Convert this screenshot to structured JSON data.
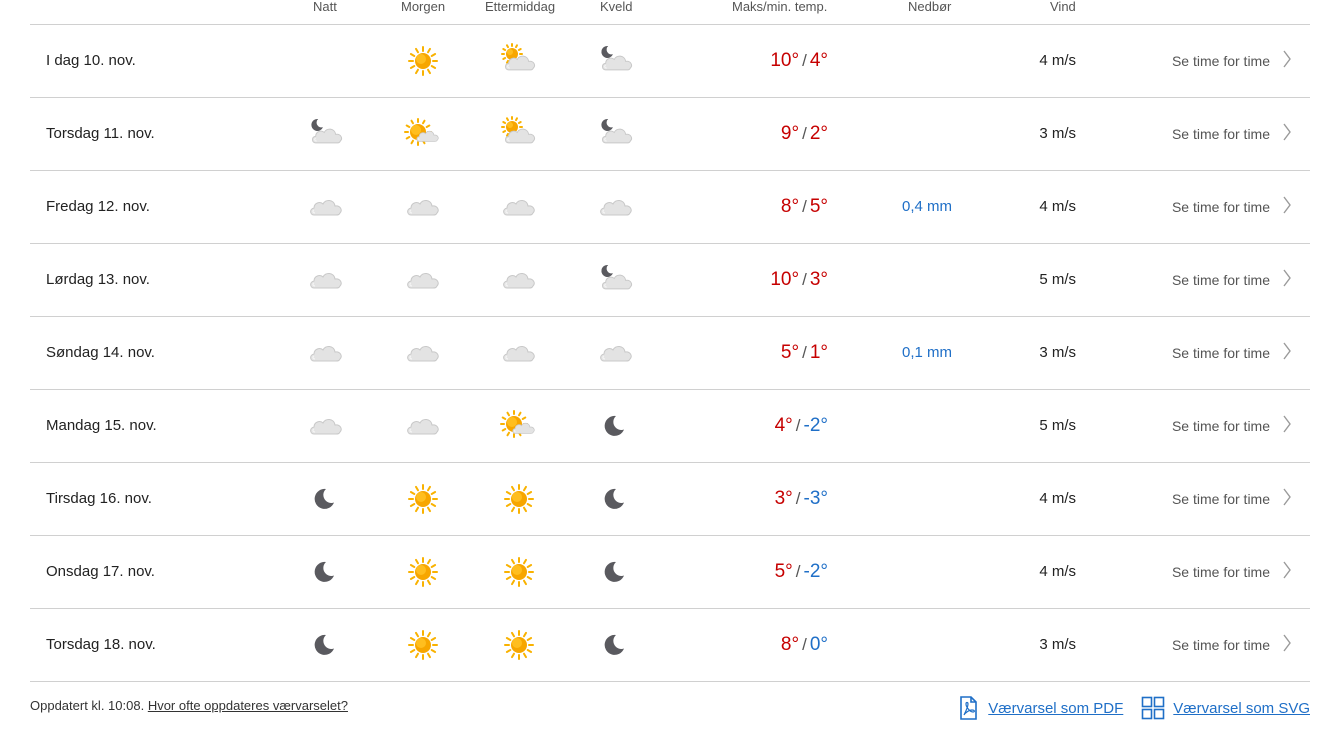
{
  "header": {
    "night": "Natt",
    "morning": "Morgen",
    "afternoon": "Ettermiddag",
    "evening": "Kveld",
    "temp": "Maks/min. temp.",
    "precip": "Nedbør",
    "wind": "Vind"
  },
  "rows": [
    {
      "day": "I dag 10. nov.",
      "icons": [
        "",
        "sun",
        "partly-day",
        "partly-night"
      ],
      "max": "10°",
      "min": "4°",
      "min_cold": false,
      "precip": "",
      "wind": "4 m/s",
      "hourly": "Se time for time"
    },
    {
      "day": "Torsdag 11. nov.",
      "icons": [
        "partly-night",
        "partly-day-bold",
        "partly-day",
        "partly-night"
      ],
      "max": "9°",
      "min": "2°",
      "min_cold": false,
      "precip": "",
      "wind": "3 m/s",
      "hourly": "Se time for time"
    },
    {
      "day": "Fredag 12. nov.",
      "icons": [
        "cloud",
        "cloud",
        "cloud",
        "cloud"
      ],
      "max": "8°",
      "min": "5°",
      "min_cold": false,
      "precip": "0,4 mm",
      "wind": "4 m/s",
      "hourly": "Se time for time"
    },
    {
      "day": "Lørdag 13. nov.",
      "icons": [
        "cloud",
        "cloud",
        "cloud",
        "partly-night"
      ],
      "max": "10°",
      "min": "3°",
      "min_cold": false,
      "precip": "",
      "wind": "5 m/s",
      "hourly": "Se time for time"
    },
    {
      "day": "Søndag 14. nov.",
      "icons": [
        "cloud",
        "cloud",
        "cloud",
        "cloud"
      ],
      "max": "5°",
      "min": "1°",
      "min_cold": false,
      "precip": "0,1 mm",
      "wind": "3 m/s",
      "hourly": "Se time for time"
    },
    {
      "day": "Mandag 15. nov.",
      "icons": [
        "cloud",
        "cloud",
        "partly-day-bold",
        "moon"
      ],
      "max": "4°",
      "min": "-2°",
      "min_cold": true,
      "precip": "",
      "wind": "5 m/s",
      "hourly": "Se time for time"
    },
    {
      "day": "Tirsdag 16. nov.",
      "icons": [
        "moon",
        "sun",
        "sun",
        "moon"
      ],
      "max": "3°",
      "min": "-3°",
      "min_cold": true,
      "precip": "",
      "wind": "4 m/s",
      "hourly": "Se time for time"
    },
    {
      "day": "Onsdag 17. nov.",
      "icons": [
        "moon",
        "sun",
        "sun",
        "moon"
      ],
      "max": "5°",
      "min": "-2°",
      "min_cold": true,
      "precip": "",
      "wind": "4 m/s",
      "hourly": "Se time for time"
    },
    {
      "day": "Torsdag 18. nov.",
      "icons": [
        "moon",
        "sun",
        "sun",
        "moon"
      ],
      "max": "8°",
      "min": "0°",
      "min_cold": true,
      "precip": "",
      "wind": "3 m/s",
      "hourly": "Se time for time"
    }
  ],
  "footer": {
    "updated": "Oppdatert kl. 10:08.",
    "how_often": "Hvor ofte oppdateres værvarselet?",
    "pdf": "Værvarsel som PDF",
    "svg": "Værvarsel som SVG"
  },
  "colors": {
    "warm": "#c60000",
    "cold": "#1f6fc7",
    "link": "#1f6fc7",
    "divider": "#d0d0d0",
    "sun": "#f7a600",
    "cloud": "#d4d4d4",
    "moon": "#5a5a5f"
  }
}
